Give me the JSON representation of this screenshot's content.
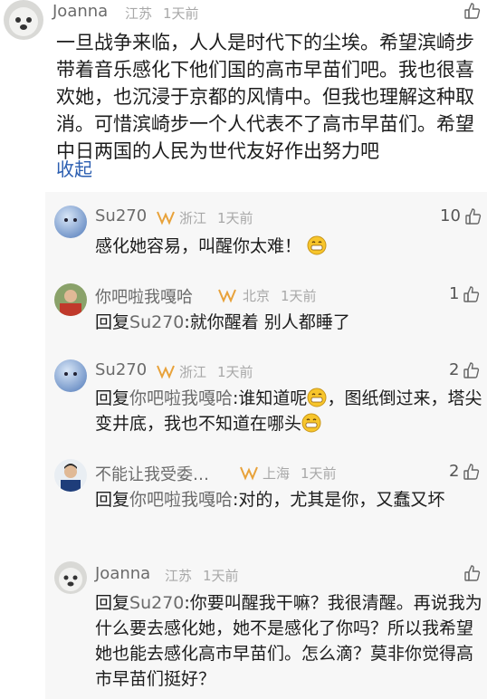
{
  "main_comment": {
    "username": "Joanna",
    "location": "江苏",
    "time": "1天前",
    "text": "一旦战争来临，人人是时代下的尘埃。希望滨崎步带着音乐感化下他们国的高市早苗们吧。我也很喜欢她，也沉浸于京都的风情中。但我也理解这种取消。可惜滨崎步一个人代表不了高市早苗们。希望中日两国的人民为世代友好作出努力吧",
    "collapse_label": "收起"
  },
  "replies": [
    {
      "username": "Su270",
      "location": "浙江",
      "time": "1天前",
      "likes": "10",
      "text": "感化她容易，叫醒你太难！"
    },
    {
      "username": "你吧啦我嘎哈",
      "location": "北京",
      "time": "1天前",
      "likes": "1",
      "reply_prefix": "回复",
      "reply_to": "Su270",
      "text": ":就你醒着 别人都睡了"
    },
    {
      "username": "Su270",
      "location": "浙江",
      "time": "1天前",
      "likes": "2",
      "reply_prefix": "回复",
      "reply_to": "你吧啦我嘎哈",
      "text_a": ":谁知道呢",
      "text_b": "，图纸倒过来，塔尖变井底，我也不知道在哪头"
    },
    {
      "username": "不能让我受委…",
      "location": "上海",
      "time": "1天前",
      "likes": "2",
      "reply_prefix": "回复",
      "reply_to": "你吧啦我嘎哈",
      "text": ":对的，尤其是你，又蠢又坏"
    },
    {
      "username": "Joanna",
      "location": "江苏",
      "time": "1天前",
      "reply_prefix": "回复",
      "reply_to": "Su270",
      "text": ":你要叫醒我干嘛？我很清醒。再说我为什么要去感化她，她不是感化了你吗？所以我希望她也能去感化高市早苗们。怎么滴？莫非你觉得高市早苗们挺好？"
    }
  ],
  "colors": {
    "link": "#2a5db0",
    "badge": "#e8a23a",
    "panel": "#f7f7f7"
  },
  "icons": {
    "like": "thumbs-up-icon",
    "badge": "vip-badge-icon",
    "emoji": "grin-emoji-icon"
  }
}
